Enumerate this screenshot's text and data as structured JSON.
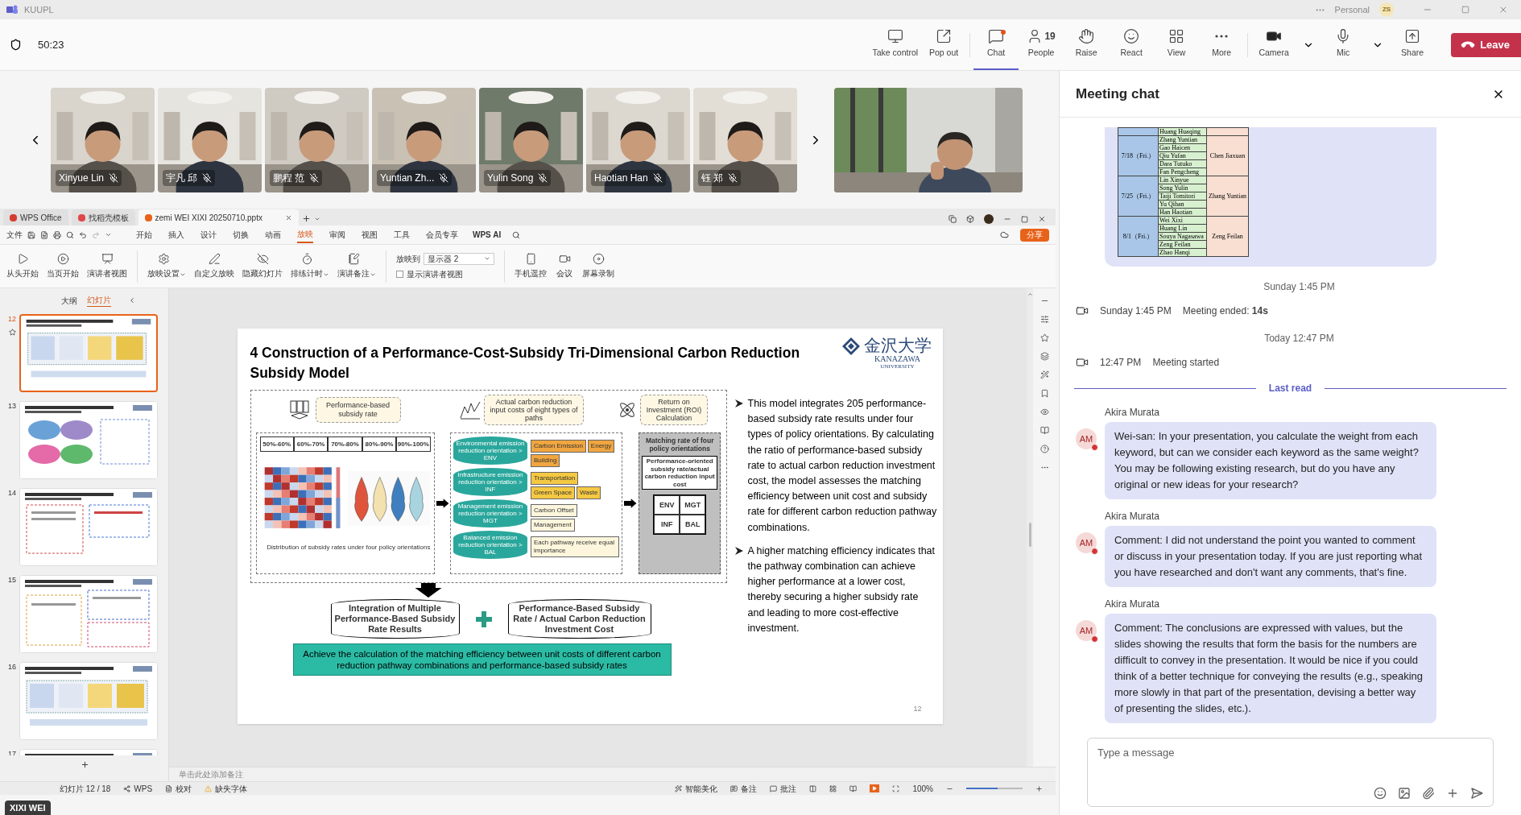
{
  "app": {
    "title": "KUUPL",
    "account": "Personal",
    "initials": "ZS"
  },
  "meeting": {
    "timer": "50:23",
    "controls": [
      {
        "kind": "take-control",
        "label": "Take control",
        "selected": false
      },
      {
        "kind": "pop-out",
        "label": "Pop out",
        "selected": false
      },
      {
        "kind": "chat",
        "label": "Chat",
        "selected": true,
        "badge": true
      },
      {
        "kind": "people",
        "label": "People",
        "count": "19",
        "selected": false
      },
      {
        "kind": "raise",
        "label": "Raise",
        "selected": false
      },
      {
        "kind": "react",
        "label": "React",
        "selected": false
      },
      {
        "kind": "view",
        "label": "View",
        "selected": false
      },
      {
        "kind": "more",
        "label": "More",
        "selected": false
      },
      {
        "kind": "camera",
        "label": "Camera",
        "selected": false,
        "menu": true
      },
      {
        "kind": "mic",
        "label": "Mic",
        "selected": false,
        "menu": true
      },
      {
        "kind": "share",
        "label": "Share",
        "selected": false
      }
    ],
    "leave": "Leave"
  },
  "participants": [
    {
      "name": "Xinyue Lin",
      "muted": true
    },
    {
      "name": "宇凡 邱",
      "muted": true
    },
    {
      "name": "鹏程 范",
      "muted": true
    },
    {
      "name": "Yuntian Zh...",
      "muted": true
    },
    {
      "name": "Yulin Song",
      "muted": true
    },
    {
      "name": "Haotian Han",
      "muted": true
    },
    {
      "name": "钰 郑",
      "muted": true
    }
  ],
  "presenter_name": "XIXI WEI",
  "wps": {
    "tabs": [
      {
        "label": "WPS Office",
        "kind": "home",
        "selected": false
      },
      {
        "label": "找稻壳模板",
        "kind": "template",
        "selected": false
      },
      {
        "label": "zemi WEI XIXI 20250710.pptx",
        "kind": "file",
        "selected": true
      }
    ],
    "file_menu": "文件",
    "menus": [
      {
        "label": "开始",
        "selected": false
      },
      {
        "label": "插入",
        "selected": false
      },
      {
        "label": "设计",
        "selected": false
      },
      {
        "label": "切换",
        "selected": false
      },
      {
        "label": "动画",
        "selected": false
      },
      {
        "label": "放映",
        "selected": true
      },
      {
        "label": "审阅",
        "selected": false
      },
      {
        "label": "视图",
        "selected": false
      },
      {
        "label": "工具",
        "selected": false
      },
      {
        "label": "会员专享",
        "selected": false
      }
    ],
    "ai_label": "WPS AI",
    "share_label": "分享",
    "ribbon_groups": [
      [
        {
          "kind": "from-start",
          "label": "从头开始"
        },
        {
          "kind": "from-current",
          "label": "当页开始"
        },
        {
          "kind": "presenter",
          "label": "演讲者视图"
        }
      ],
      [
        {
          "kind": "setup",
          "label": "放映设置",
          "menu": true
        },
        {
          "kind": "custom",
          "label": "自定义放映"
        },
        {
          "kind": "hide",
          "label": "隐藏幻灯片"
        },
        {
          "kind": "timing",
          "label": "排练计时",
          "menu": true
        },
        {
          "kind": "notes",
          "label": "演讲备注",
          "menu": true
        }
      ]
    ],
    "play_to": {
      "label": "放映到",
      "value": "显示器 2"
    },
    "presenter_checkbox": {
      "label": "显示演讲者视图",
      "checked": false
    },
    "ribbon_tail": [
      {
        "kind": "phone",
        "label": "手机遥控"
      },
      {
        "kind": "meeting",
        "label": "会议"
      },
      {
        "kind": "record",
        "label": "屏幕录制"
      }
    ],
    "panel_tabs": [
      {
        "label": "大纲",
        "selected": false
      },
      {
        "label": "幻灯片",
        "selected": true
      }
    ],
    "thumbnails": [
      {
        "number": "12",
        "selected": true
      },
      {
        "number": "13",
        "selected": false
      },
      {
        "number": "14",
        "selected": false
      },
      {
        "number": "15",
        "selected": false
      },
      {
        "number": "16",
        "selected": false
      },
      {
        "number": "17",
        "selected": false
      }
    ],
    "notes_placeholder": "单击此处添加备注",
    "status": {
      "slide": "幻灯片 12 / 18",
      "left": [
        {
          "kind": "wps",
          "label": "WPS"
        },
        {
          "kind": "proof",
          "label": "校对"
        },
        {
          "kind": "font",
          "label": "缺失字体"
        }
      ],
      "right": [
        {
          "kind": "beautify",
          "label": "智能美化"
        },
        {
          "kind": "notes",
          "label": "备注"
        },
        {
          "kind": "comments",
          "label": "批注"
        }
      ],
      "zoom": "100%",
      "level": 0.55
    }
  },
  "slide": {
    "title": "4  Construction of a Performance-Cost-Subsidy Tri-Dimensional Carbon Reduction Subsidy Model",
    "logo": {
      "name": "金沢大学",
      "latin": "KANAZAWA",
      "sub": "UNIVERSITY"
    },
    "inputs": [
      "Performance-based subsidy rate",
      "Actual carbon reduction input costs of eight types of paths",
      "Return on Investment (ROI) Calculation"
    ],
    "ranges": [
      "50%-60%",
      "60%-70%",
      "70%-80%",
      "80%-90%",
      "90%-100%"
    ],
    "distribution_caption": "Distribution of subsidy rates under four policy orientations",
    "orientations": [
      "Environmental emission reduction orientation > ENV",
      "Infrastructure emission reduction orientation > INF",
      "Management emission reduction orientation > MGT",
      "Balanced emission reduction orientation > BAL"
    ],
    "pathway_rows": [
      [
        "Carbon Emission",
        "Energy",
        "Building"
      ],
      [
        "Transportation",
        "Green Space",
        "Waste"
      ],
      [
        "Carbon Offset",
        "Management"
      ],
      [
        "Each pathway receive equal importance"
      ]
    ],
    "matching": {
      "title": "Matching rate of four policy orientations",
      "formula": "Performance-oriented subsidy rate/actual carbon reduction input cost",
      "codes": [
        "ENV",
        "MGT",
        "INF",
        "BAL"
      ]
    },
    "results": [
      "Integration of Multiple Performance-Based Subsidy Rate Results",
      "Performance-Based Subsidy Rate / Actual Carbon Reduction Investment Cost"
    ],
    "conclusion": "Achieve the calculation of the matching efficiency between unit costs of different carbon reduction pathway combinations and performance-based subsidy rates",
    "bullets": [
      "This model integrates 205 performance-based subsidy rate results under four types of policy orientations. By calculating the ratio of performance-based subsidy rate to actual carbon reduction investment cost, the model assesses the matching efficiency between unit cost and subsidy rate for different carbon reduction pathway combinations.",
      "A higher matching efficiency indicates that the pathway combination can achieve higher performance at a lower cost, thereby securing a higher subsidy rate and leading to more cost-effective investment."
    ],
    "page": "12"
  },
  "chat": {
    "title": "Meeting chat",
    "schedule": [
      {
        "names": [
          "Huang Huaqing"
        ]
      },
      {
        "date": "7/18（Fri.）",
        "names": [
          "Zhang Yuntian",
          "Gao Haicen",
          "Qiu Yufan",
          "Dara Tutuko",
          "Fan Pengcheng"
        ],
        "host": "Chen Jiaxuan"
      },
      {
        "date": "7/25（Fri.）",
        "names": [
          "Lin Xinyue",
          "Song Yulin",
          "Taiji Tomitori",
          "Yu Qihan",
          "Han Haotian"
        ],
        "host": "Zhang Yuntian"
      },
      {
        "date": "8/1（Fri.）",
        "names": [
          "Wei Xixi",
          "Huang Lin",
          "Souya Nagasawa",
          "Zeng Feilan",
          "Zhao Hanqi"
        ],
        "host": "Zeng Feilan"
      }
    ],
    "events": [
      {
        "divider": "Sunday 1:45 PM",
        "time": "Sunday 1:45 PM",
        "text": "Meeting ended: ",
        "detail": "14s"
      },
      {
        "divider": "Today 12:47 PM",
        "time": "12:47 PM",
        "text": "Meeting started"
      }
    ],
    "last_read": "Last read",
    "messages": [
      {
        "author": "Akira Murata",
        "initials": "AM",
        "color": "#d13438",
        "text": "Wei-san: In your presentation, you calculate the weight from each keyword, but can we consider each keyword as the same weight? You may be following existing research, but do you have any original or new ideas for your research?"
      },
      {
        "author": "Akira Murata",
        "initials": "AM",
        "color": "#d13438",
        "text": "Comment: I did not understand the point you wanted to comment or discuss in your presentation today. If you are just reporting what you have researched and don't want any comments, that's fine."
      },
      {
        "author": "Akira Murata",
        "initials": "AM",
        "color": "#d13438",
        "text": "Comment: The conclusions are expressed with values, but the slides showing the results that form the basis for the numbers are difficult to convey in the presentation. It would be nice if you could think of a better technique for conveying the results (e.g., speaking more slowly in that part of the presentation, devising a better way of presenting the slides, etc.)."
      }
    ],
    "input_placeholder": "Type a message"
  }
}
